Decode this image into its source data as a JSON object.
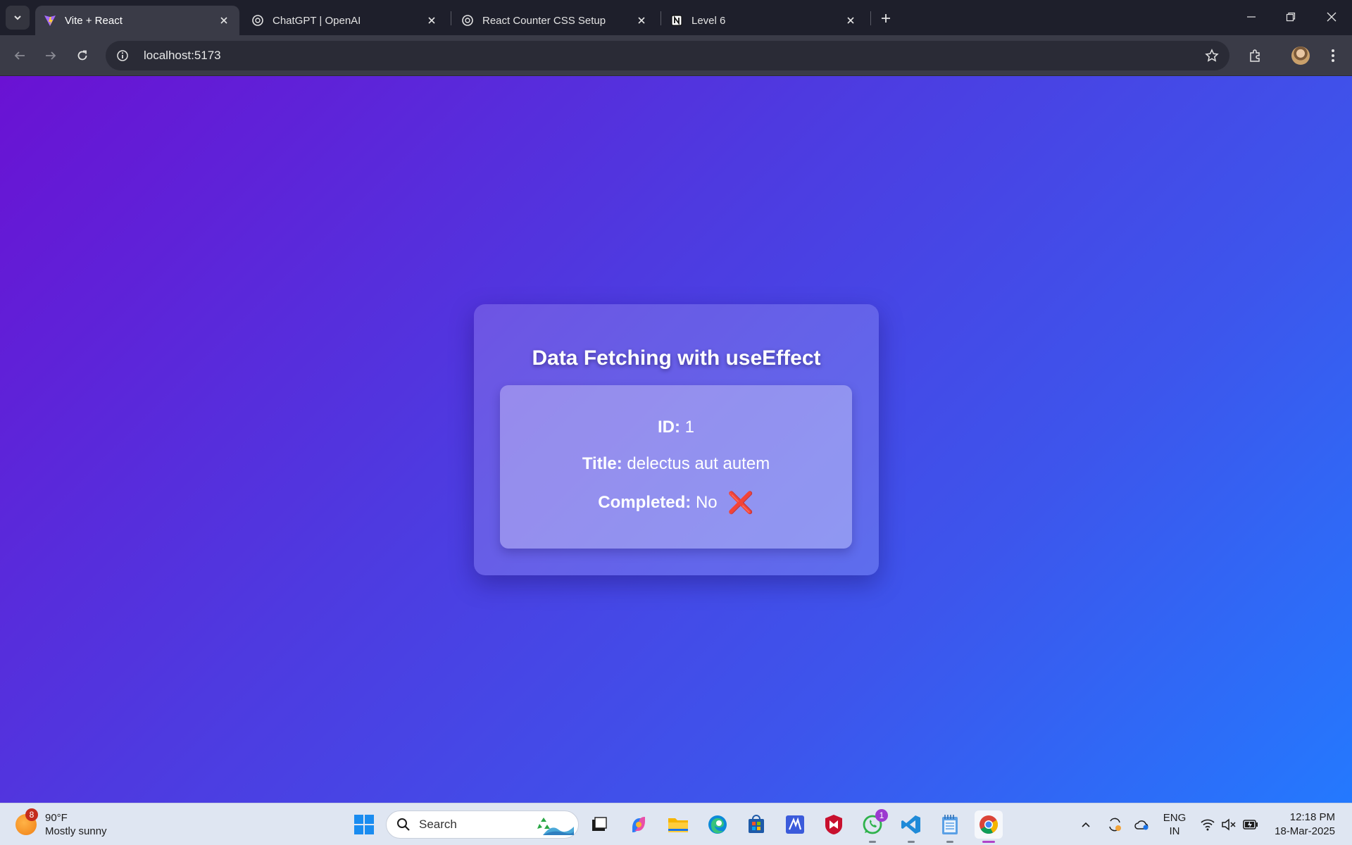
{
  "browser": {
    "tabs": [
      {
        "title": "Vite + React",
        "icon": "vite-icon",
        "active": true
      },
      {
        "title": "ChatGPT | OpenAI",
        "icon": "openai-icon",
        "active": false
      },
      {
        "title": "React Counter CSS Setup",
        "icon": "openai-icon",
        "active": false
      },
      {
        "title": "Level 6",
        "icon": "notion-icon",
        "active": false
      }
    ],
    "address": "localhost:5173"
  },
  "page": {
    "heading": "Data Fetching with useEffect",
    "fields": [
      {
        "label": "ID:",
        "value": "1"
      },
      {
        "label": "Title:",
        "value": "delectus aut autem"
      },
      {
        "label": "Completed:",
        "value": "No",
        "mark": "❌"
      }
    ],
    "background_colors": [
      "#6a12d3",
      "#2479fe"
    ]
  },
  "taskbar": {
    "weather": {
      "temp": "90°F",
      "condition": "Mostly sunny",
      "badge": "8"
    },
    "search_placeholder": "Search",
    "whatsapp_badge": "1",
    "language": {
      "line1": "ENG",
      "line2": "IN"
    },
    "clock": {
      "time": "12:18 PM",
      "date": "18-Mar-2025"
    }
  }
}
